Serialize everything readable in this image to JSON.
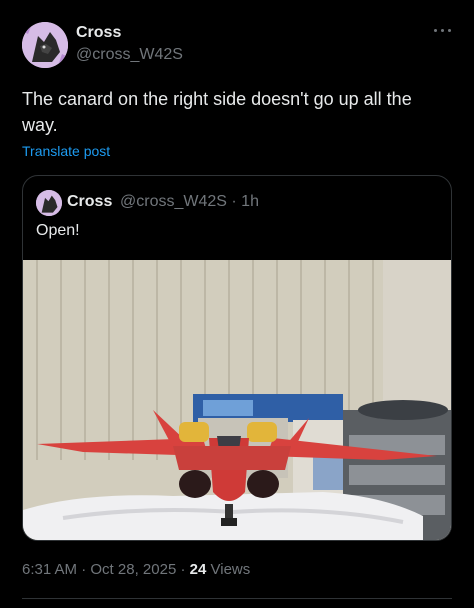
{
  "post": {
    "author_name": "Cross",
    "author_handle": "@cross_W42S",
    "text": "The canard on the right side doesn't go up all the way.",
    "translate_label": "Translate post",
    "more_icon": "more-horizontal-icon"
  },
  "quoted_post": {
    "author_name": "Cross",
    "author_handle": "@cross_W42S",
    "separator": "·",
    "age": "1h",
    "text": "Open!",
    "media": "photo"
  },
  "meta": {
    "time": "6:31 AM",
    "sep1": "·",
    "date": "Oct 28, 2025",
    "sep2": "·",
    "views_count": "24",
    "views_label": "Views"
  },
  "colors": {
    "background": "#000000",
    "text_primary": "#e7e9ea",
    "text_secondary": "#71767b",
    "link": "#1d9bf0",
    "border": "#2f3336"
  }
}
